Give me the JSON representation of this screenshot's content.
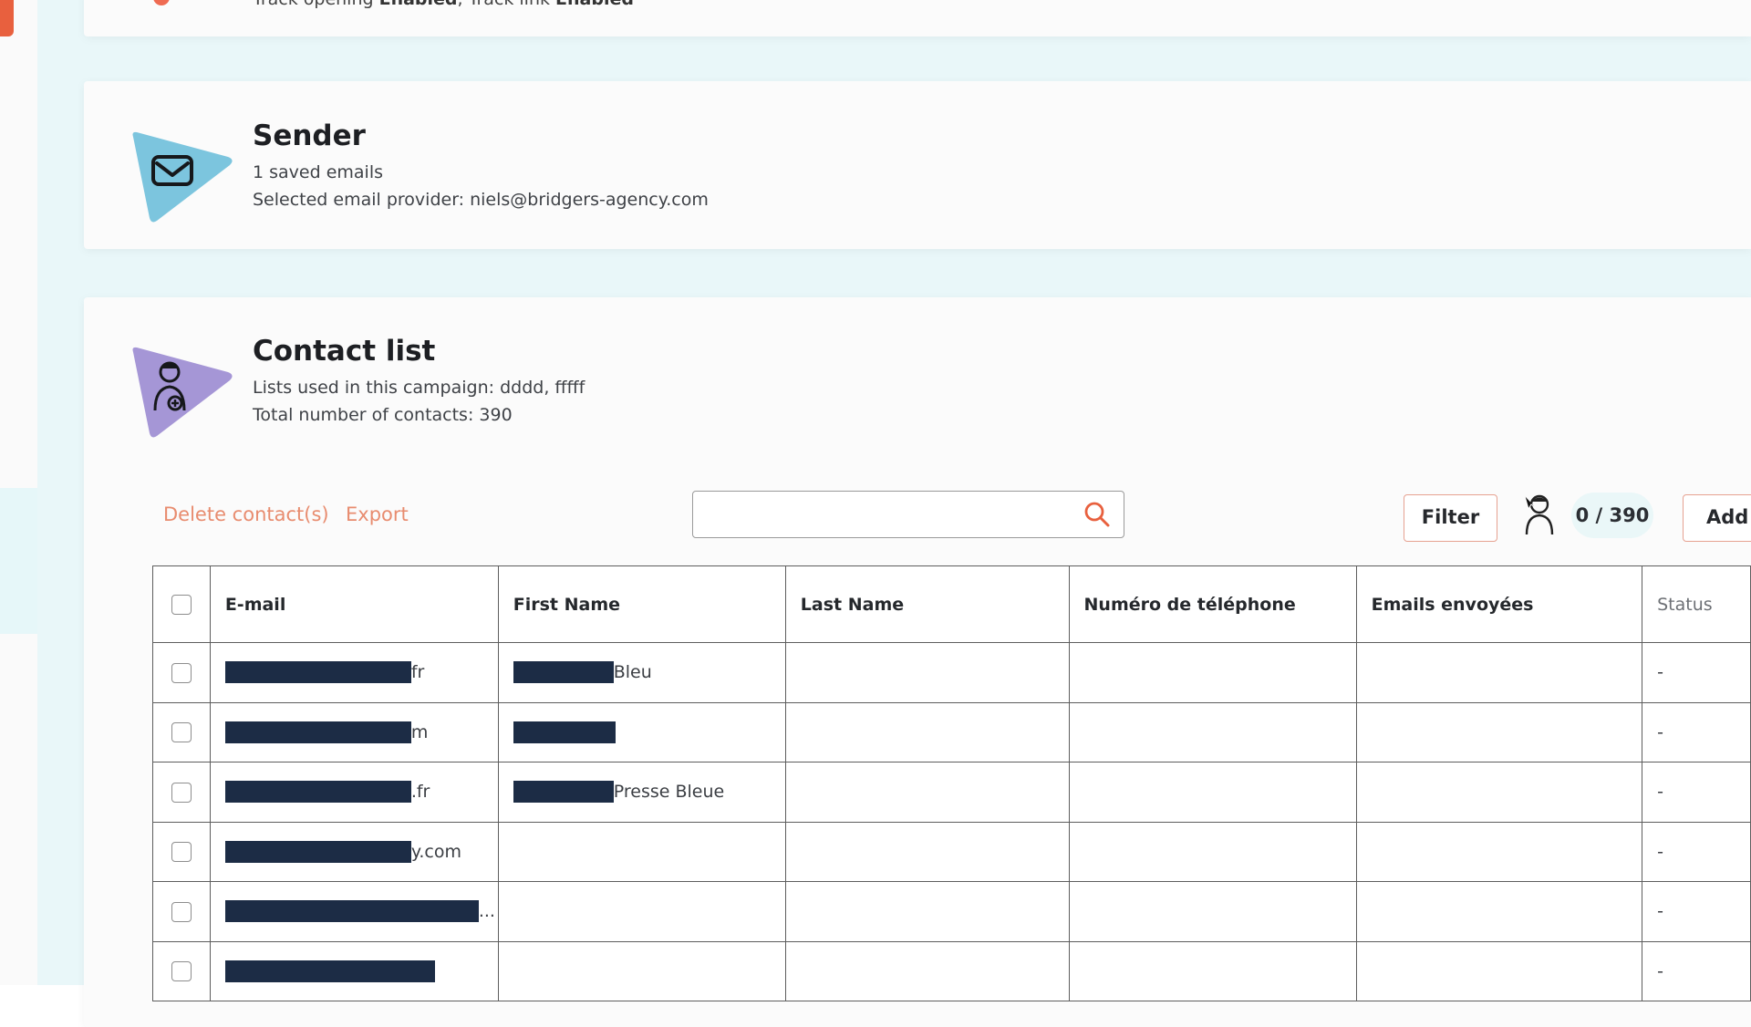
{
  "top_card": {
    "text_prefix": "Track opening ",
    "text_value1": "Enabled",
    "text_mid": ", Track link ",
    "text_value2": "Enabled"
  },
  "sender": {
    "title": "Sender",
    "saved_emails": "1 saved emails",
    "provider": "Selected email provider: niels@bridgers-agency.com",
    "icon": "envelope-icon"
  },
  "contacts": {
    "title": "Contact list",
    "lists_used": "Lists used in this campaign: dddd, fffff",
    "total": "Total number of contacts: 390",
    "icon": "person-add-icon"
  },
  "toolbar": {
    "delete_label": "Delete contact(s)",
    "export_label": "Export",
    "search_placeholder": "",
    "filter_label": "Filter",
    "count_label": "0 / 390",
    "add_label": "Add contact"
  },
  "table": {
    "headers": [
      "E-mail",
      "First Name",
      "Last Name",
      "Numéro de téléphone",
      "Emails envoyées",
      "Status"
    ],
    "rows": [
      {
        "email_suffix": "fr",
        "first_suffix": "Bleu",
        "last": "",
        "phone": "",
        "sent": "",
        "status": "-"
      },
      {
        "email_suffix": "m",
        "first_suffix": "",
        "last": "",
        "phone": "",
        "sent": "",
        "status": "-"
      },
      {
        "email_suffix": ".fr",
        "first_suffix": "Presse Bleue",
        "last": "",
        "phone": "",
        "sent": "",
        "status": "-"
      },
      {
        "email_suffix": "y.com",
        "first_suffix": "",
        "last": "",
        "phone": "",
        "sent": "",
        "status": "-"
      },
      {
        "email_suffix": "...",
        "first_suffix": "",
        "last": "",
        "phone": "",
        "sent": "",
        "status": "-"
      },
      {
        "email_suffix": "",
        "first_suffix": "",
        "last": "",
        "phone": "",
        "sent": "",
        "status": "-"
      }
    ]
  },
  "colors": {
    "accent": "#e8603e",
    "link": "#e88c6f",
    "sender_icon": "#7cc5de",
    "contact_icon": "#a596d6",
    "background": "#e9f7f9",
    "redaction": "#1c2c45"
  }
}
